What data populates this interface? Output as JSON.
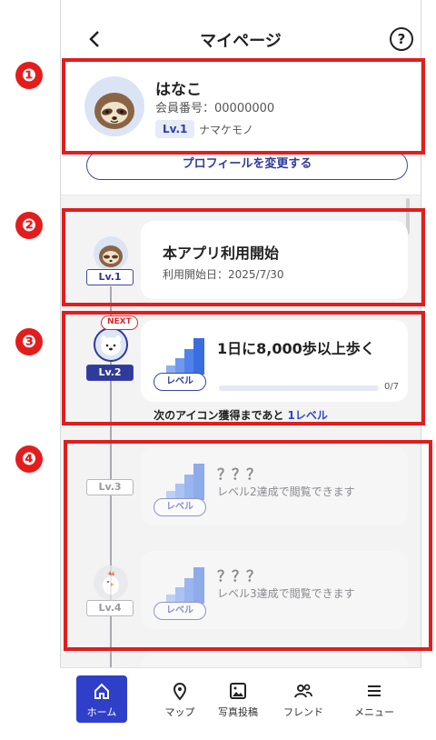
{
  "header": {
    "title": "マイページ",
    "help": "?"
  },
  "profile": {
    "name": "はなこ",
    "member_number": "会員番号：00000000",
    "level": "Lv.1",
    "level_name": "ナマケモノ",
    "edit_button": "プロフィールを変更する"
  },
  "timeline": {
    "item1": {
      "level": "Lv.1",
      "title": "本アプリ利用開始",
      "sub": "利用開始日：2025/7/30"
    },
    "item2": {
      "next_badge": "NEXT",
      "level": "Lv.2",
      "title": "1日に8,000歩以上歩く",
      "pill": "レベル",
      "progress_text": "0/7",
      "progress_fraction": 0.0,
      "next_prefix": "次のアイコン獲得まであと ",
      "next_emphasis": "1レベル"
    },
    "item3": {
      "level": "Lv.3",
      "title": "？？？",
      "sub": "レベル2達成で閲覧できます",
      "pill": "レベル"
    },
    "item4": {
      "level": "Lv.4",
      "title": "？？？",
      "sub": "レベル3達成で閲覧できます",
      "pill": "レベル"
    }
  },
  "annotations": [
    "❶",
    "❷",
    "❸",
    "❹"
  ],
  "nav": {
    "home": "ホーム",
    "map": "マップ",
    "photo": "写真投稿",
    "friend": "フレンド",
    "menu": "メニュー"
  },
  "colors": {
    "accent": "#2f3fc8",
    "annotation_red": "#e21d1d",
    "level_blue": "#4a78e6"
  }
}
